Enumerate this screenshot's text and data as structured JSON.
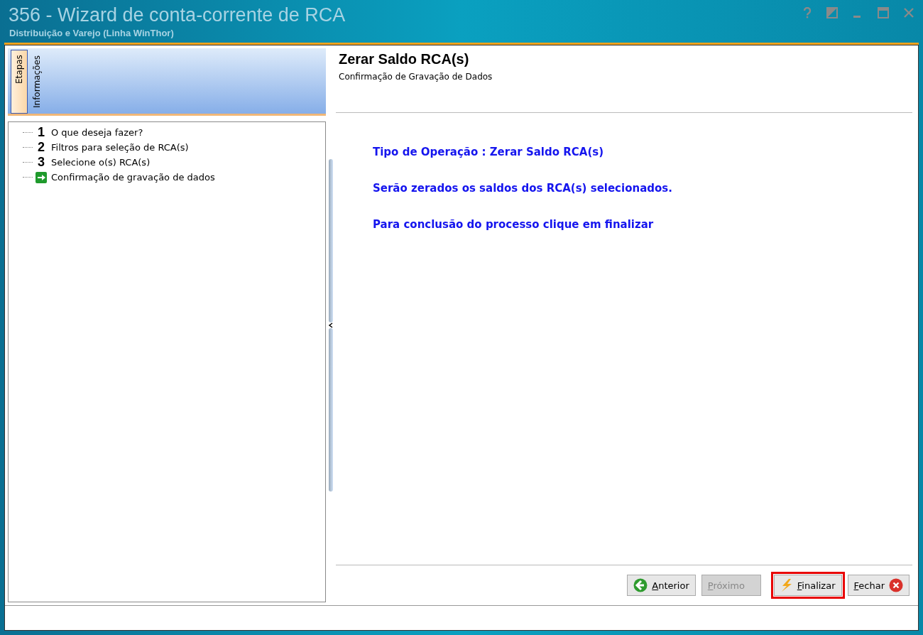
{
  "window": {
    "title": "356 - Wizard de conta-corrente de RCA",
    "subtitle": "Distribuição e Varejo (Linha WinThor)"
  },
  "side_tabs": [
    {
      "label": "Etapas",
      "selected": true
    },
    {
      "label": "Informações",
      "selected": false
    }
  ],
  "steps": [
    {
      "kind": "number",
      "marker": "1",
      "label": "O que deseja fazer?"
    },
    {
      "kind": "number",
      "marker": "2",
      "label": "Filtros para seleção de RCA(s)"
    },
    {
      "kind": "number",
      "marker": "3",
      "label": "Selecione o(s) RCA(s)"
    },
    {
      "kind": "current",
      "label": "Confirmação de gravação de dados"
    }
  ],
  "header": {
    "title": "Zerar Saldo RCA(s)",
    "subtitle": "Confirmação de Gravação de Dados"
  },
  "messages": [
    "Tipo de Operação : Zerar Saldo RCA(s)",
    "Serão zerados os saldos dos RCA(s) selecionados.",
    "Para conclusão do processo clique em finalizar"
  ],
  "buttons": [
    {
      "label": "Anterior",
      "kind": "back",
      "disabled": false,
      "highlighted": false
    },
    {
      "label": "Próximo",
      "kind": "plain",
      "disabled": true,
      "highlighted": false
    },
    {
      "label": "Finalizar",
      "kind": "finish",
      "disabled": false,
      "highlighted": true
    },
    {
      "label": "Fechar",
      "kind": "close",
      "disabled": false,
      "highlighted": false
    }
  ]
}
